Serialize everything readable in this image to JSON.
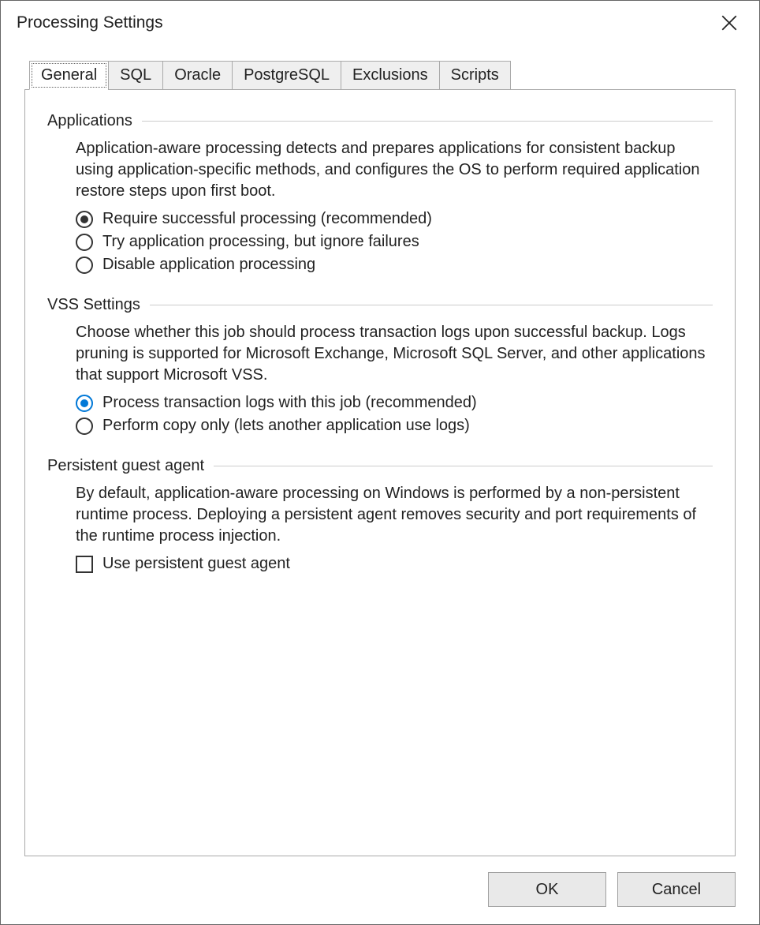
{
  "window": {
    "title": "Processing Settings"
  },
  "tabs": [
    {
      "label": "General",
      "active": true
    },
    {
      "label": "SQL",
      "active": false
    },
    {
      "label": "Oracle",
      "active": false
    },
    {
      "label": "PostgreSQL",
      "active": false
    },
    {
      "label": "Exclusions",
      "active": false
    },
    {
      "label": "Scripts",
      "active": false
    }
  ],
  "groups": {
    "applications": {
      "title": "Applications",
      "desc": "Application-aware processing detects and prepares applications for consistent backup using application-specific methods, and configures the OS to perform required application restore steps upon first boot.",
      "options": [
        {
          "label": "Require successful processing (recommended)",
          "selected": true
        },
        {
          "label": "Try application processing, but ignore failures",
          "selected": false
        },
        {
          "label": "Disable application processing",
          "selected": false
        }
      ]
    },
    "vss": {
      "title": "VSS Settings",
      "desc": "Choose whether this job should process transaction logs upon successful backup. Logs pruning is supported for Microsoft Exchange, Microsoft SQL Server, and other applications that support Microsoft VSS.",
      "options": [
        {
          "label": "Process transaction logs with this job (recommended)",
          "selected": true
        },
        {
          "label": "Perform copy only (lets another application use logs)",
          "selected": false
        }
      ]
    },
    "agent": {
      "title": "Persistent guest agent",
      "desc": "By default, application-aware processing on Windows is performed by a non-persistent runtime process. Deploying a persistent agent removes security and port requirements of the runtime process injection.",
      "checkbox": {
        "label": "Use persistent guest agent",
        "checked": false
      }
    }
  },
  "buttons": {
    "ok": "OK",
    "cancel": "Cancel"
  }
}
